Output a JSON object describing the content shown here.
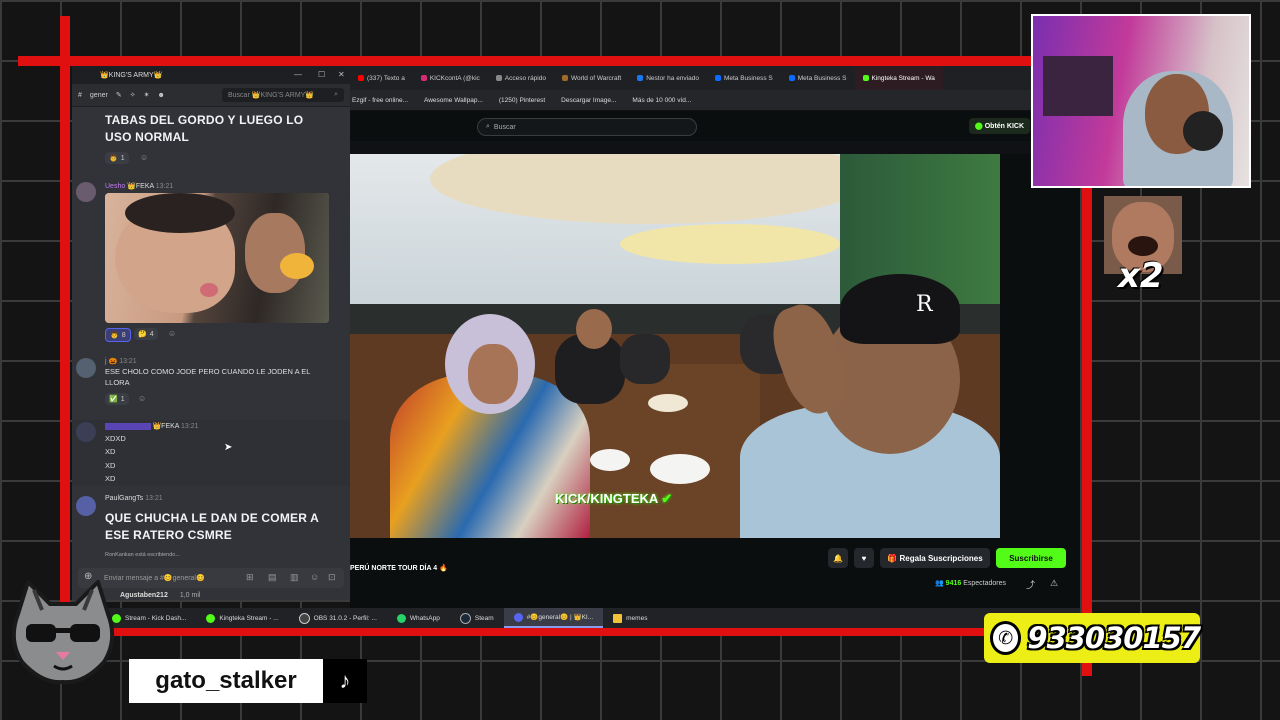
{
  "discord": {
    "title": "👑KING'S ARMY👑",
    "channel": "gener",
    "search_placeholder": "Buscar 👑KING'S ARMY👑",
    "messages": [
      {
        "text": "TABAS DEL GORDO Y LUEGO LO USO NORMAL",
        "reactions": [
          {
            "emoji": "👨",
            "count": "1"
          }
        ]
      },
      {
        "user": "Uesho",
        "badge": "FEKA",
        "time": "13:21",
        "reactions": [
          {
            "emoji": "👨",
            "count": "8"
          },
          {
            "emoji": "🤔",
            "count": "4"
          }
        ]
      },
      {
        "user": "j",
        "time": "13:21",
        "text": "ESE CHOLO COMO JODE PERO CUANDO LE JODEN A EL LLORA",
        "reactions": [
          {
            "emoji": "✅",
            "count": "1"
          }
        ]
      },
      {
        "badge": "FEKA",
        "time": "13:21",
        "lines": [
          "XDXD",
          "XD",
          "XD",
          "XD"
        ]
      },
      {
        "user": "PaulGangTs",
        "time": "13:21",
        "text": "QUE CHUCHA LE DAN DE COMER A ESE RATERO CSMRE"
      }
    ],
    "typing": "RonKankan está escribiendo...",
    "input_placeholder": "Enviar mensaje a #😊general😊",
    "voice_user": "Agustaben212",
    "voice_ping": "1,0 mil"
  },
  "browser": {
    "tabs": [
      "(337) Texto a",
      "KICKcontA (@kic",
      "Acceso rápido",
      "World of Warcraft",
      "Nestor ha enviado",
      "Meta Business S",
      "Meta Business S",
      "Kingteka Stream - Wa"
    ],
    "bookmarks": [
      "Ezgif - free online...",
      "Awesome Wallpap...",
      "(1250) Pinterest",
      "Descargar Image...",
      "Más de 10 000 víd..."
    ],
    "search_placeholder": "Buscar",
    "get_kick": "Obtén KICK",
    "watermark": "KICK/KINGTEKA",
    "stream_title": "PERÚ NORTE TOUR DÍA 4 🔥",
    "gift_label": "Regala Suscripciones",
    "subscribe_label": "Suscribirse",
    "viewers": "9416",
    "viewers_label": "Espectadores"
  },
  "taskbar": [
    "Stream - Kick Dash...",
    "Kingteka Stream - ...",
    "OBS 31.0.2 - Perfil: ...",
    "WhatsApp",
    "Steam",
    "#😊general😊 | 👑KI...",
    "memes"
  ],
  "overlay": {
    "multiplier": "x2",
    "phone": "933030157",
    "handle": "gato_stalker"
  },
  "colors": {
    "frame_red": "#e01010",
    "kick_green": "#53fc18",
    "phone_yellow": "#ecee16"
  }
}
